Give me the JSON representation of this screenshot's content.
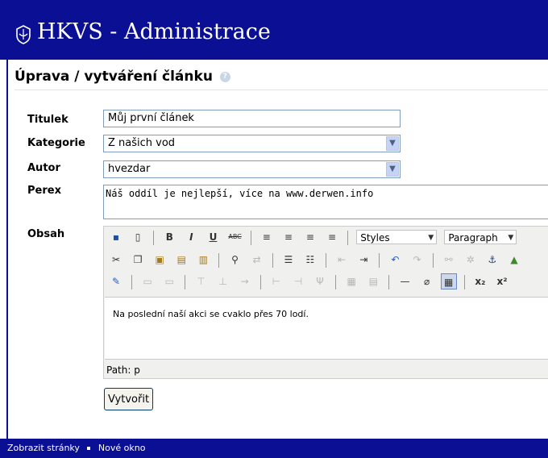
{
  "header": {
    "app_title": "HKVS - Administrace",
    "logo_icon": "emblem-icon"
  },
  "page": {
    "title": "Úprava / vytváření článku",
    "help_icon": "help-icon"
  },
  "form": {
    "title_label": "Titulek",
    "title_value": "Můj první článek",
    "category_label": "Kategorie",
    "category_value": "Z našich vod",
    "author_label": "Autor",
    "author_value": "hvezdar",
    "perex_label": "Perex",
    "perex_value": "Náš oddíl je nejlepší, více na www.derwen.info",
    "content_label": "Obsah",
    "submit_label": "Vytvořit"
  },
  "editor": {
    "styles_label": "Styles",
    "format_label": "Paragraph",
    "body_text": "Na poslední naší akci se cvaklo přes 70 lodí.",
    "path_text": "Path: p"
  },
  "footer": {
    "link_1": "Zobrazit stránky",
    "link_2": "Nové okno"
  },
  "colors": {
    "brand": "#0b0f93"
  }
}
